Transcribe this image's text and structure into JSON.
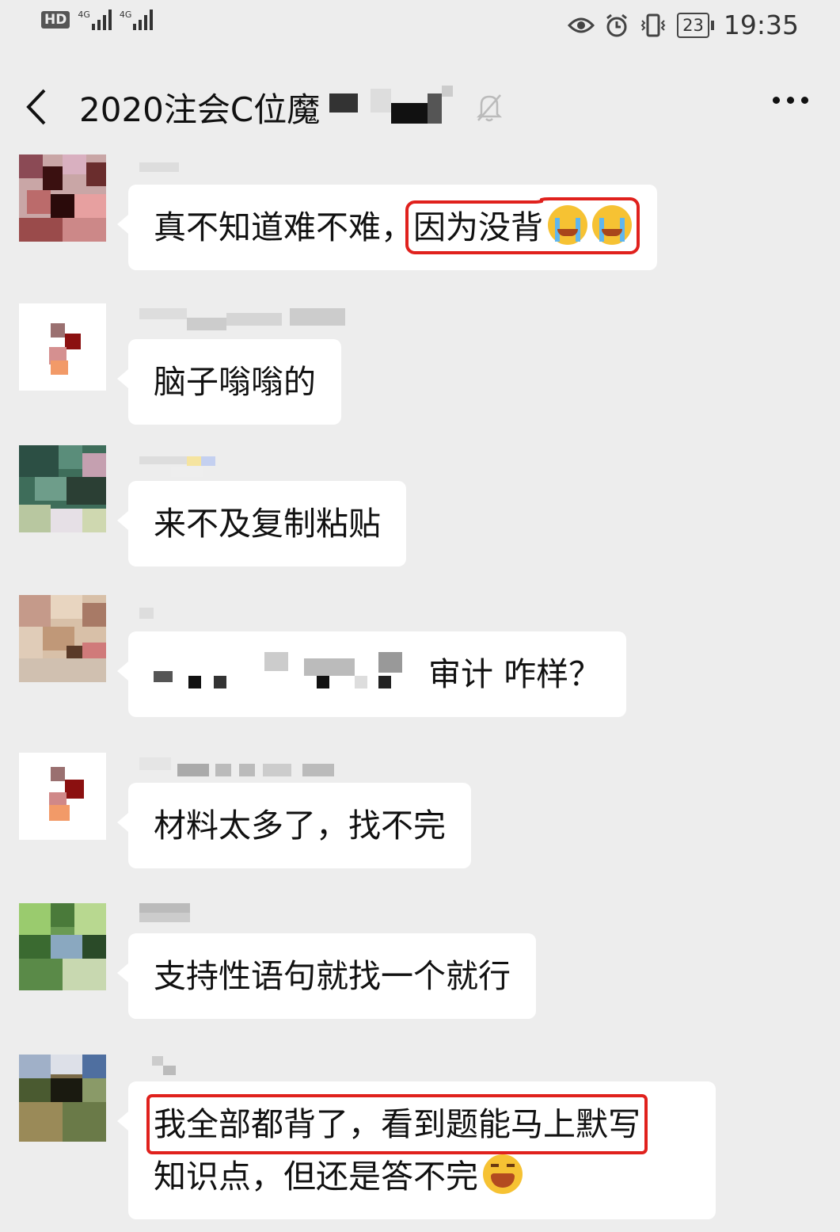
{
  "status_bar": {
    "hd_label": "HD",
    "net1_label": "4G",
    "net2_label": "4G",
    "battery_level": "23",
    "time": "19:35"
  },
  "header": {
    "title": "2020注会C位魔",
    "back_icon": "chevron-left-icon",
    "mute_icon": "bell-off-icon",
    "more_icon": "more-dots-icon"
  },
  "messages": [
    {
      "part1": "真不知道难不难，",
      "part2": "因为没背"
    },
    {
      "text": "脑子嗡嗡的"
    },
    {
      "text": "来不及复制粘贴"
    },
    {
      "text": "审计  咋样？"
    },
    {
      "text": "材料太多了，找不完"
    },
    {
      "text": "支持性语句就找一个就行"
    },
    {
      "line1": "我全部都背了，看到题能马上默写",
      "line2": "知识点，但还是答不完"
    }
  ],
  "colors": {
    "background": "#ededed",
    "bubble": "#ffffff",
    "highlight": "#e0211d"
  }
}
